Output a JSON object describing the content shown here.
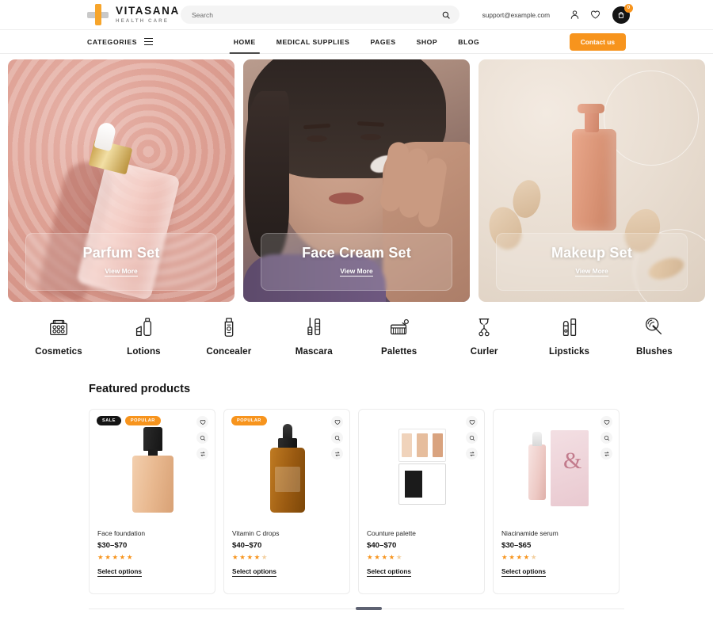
{
  "header": {
    "logo": {
      "name": "VITASANA",
      "tagline": "HEALTH CARE"
    },
    "search": {
      "placeholder": "Search",
      "value": ""
    },
    "email": "support@example.com",
    "cart_count": "0"
  },
  "nav": {
    "categories_label": "CATEGORIES",
    "items": [
      {
        "label": "HOME",
        "active": true
      },
      {
        "label": "MEDICAL SUPPLIES",
        "active": false
      },
      {
        "label": "PAGES",
        "active": false
      },
      {
        "label": "SHOP",
        "active": false
      },
      {
        "label": "BLOG",
        "active": false
      }
    ],
    "contact_label": "Contact us"
  },
  "heroes": [
    {
      "title": "Parfum Set",
      "link": "View More"
    },
    {
      "title": "Face Cream Set",
      "link": "View More"
    },
    {
      "title": "Makeup Set",
      "link": "View More"
    }
  ],
  "categories": [
    {
      "label": "Cosmetics",
      "icon": "cosmetics-case-icon"
    },
    {
      "label": "Lotions",
      "icon": "lotion-bottle-icon"
    },
    {
      "label": "Concealer",
      "icon": "concealer-tube-icon"
    },
    {
      "label": "Mascara",
      "icon": "mascara-wand-icon"
    },
    {
      "label": "Palettes",
      "icon": "eyeshadow-palette-icon"
    },
    {
      "label": "Curler",
      "icon": "eyelash-curler-icon"
    },
    {
      "label": "Lipsticks",
      "icon": "lipstick-icon"
    },
    {
      "label": "Blushes",
      "icon": "blush-brush-icon"
    }
  ],
  "featured": {
    "title": "Featured products",
    "action_labels": {
      "wishlist": "wishlist-icon",
      "quickview": "search-icon",
      "compare": "compare-icon"
    },
    "products": [
      {
        "name": "Face foundation",
        "price": "$30–$70",
        "rating": 5,
        "cta": "Select options",
        "badges": [
          "SALE",
          "POPULAR"
        ]
      },
      {
        "name": "Vitamin C drops",
        "price": "$40–$70",
        "rating": 4,
        "cta": "Select options",
        "badges": [
          "POPULAR"
        ]
      },
      {
        "name": "Counture palette",
        "price": "$40–$70",
        "rating": 4,
        "cta": "Select options",
        "badges": []
      },
      {
        "name": "Niacinamide serum",
        "price": "$30–$65",
        "rating": 4,
        "cta": "Select options",
        "badges": []
      }
    ]
  },
  "colors": {
    "accent": "#f7941d",
    "dark": "#141414",
    "star": "#f7941d",
    "star_empty": "#f3cf9f",
    "border": "#ececec"
  }
}
